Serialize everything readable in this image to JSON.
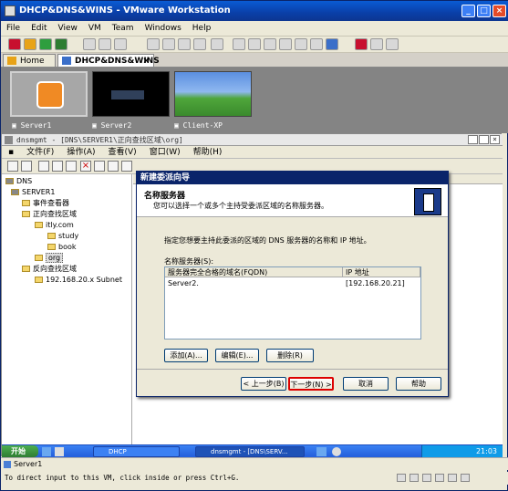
{
  "window": {
    "title": "DHCP&DNS&WINS - VMware Workstation"
  },
  "menu": [
    "File",
    "Edit",
    "View",
    "VM",
    "Team",
    "Windows",
    "Help"
  ],
  "tabs": {
    "home": "Home",
    "active": "DHCP&DNS&WINS"
  },
  "thumbnails": [
    "Server1",
    "Server2",
    "Client-XP"
  ],
  "inner": {
    "title": "dnsmgmt - [DNS\\SERVER1\\正向查找区域\\org]",
    "menu": [
      "文件(F)",
      "操作(A)",
      "查看(V)",
      "窗口(W)",
      "帮助(H)"
    ]
  },
  "tree": {
    "root": "DNS",
    "server": "SERVER1",
    "event": "事件查看器",
    "forward": "正向查找区域",
    "itly": "itly.com",
    "study": "study",
    "book": "book",
    "org": "org",
    "reverse": "反向查找区域",
    "subnet": "192.168.20.x Subnet"
  },
  "dialog": {
    "title": "新建委派向导",
    "heading": "名称服务器",
    "subheading": "您可以选择一个或多个主持受委派区域的名称服务器。",
    "instruction": "指定您想要主持此委派的区域的 DNS 服务器的名称和 IP 地址。",
    "list_label": "名称服务器(S):",
    "columns": [
      "服务器完全合格的域名(FQDN)",
      "IP 地址"
    ],
    "rows": [
      {
        "fqdn": "Server2.",
        "ip": "[192.168.20.21]"
      }
    ],
    "add": "添加(A)...",
    "edit": "编辑(E)...",
    "delete": "删除(R)",
    "back": "< 上一步(B)",
    "next": "下一步(N) >",
    "cancel": "取消",
    "help": "帮助"
  },
  "taskbar": {
    "start": "开始",
    "item1": "DHCP",
    "item2": "dnsmgmt - [DNS\\SERV...",
    "clock": "21:03"
  },
  "status": "Server1",
  "info": "To direct input to this VM, click inside or press Ctrl+G."
}
